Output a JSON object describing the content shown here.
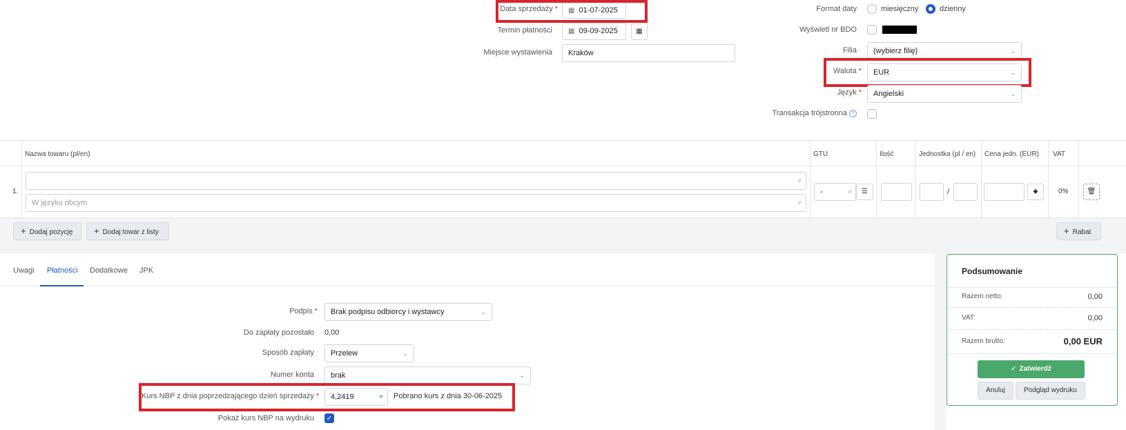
{
  "header": {
    "data_sprzedazy": {
      "label": "Data sprzedaży",
      "required": "*",
      "value": "01-07-2025"
    },
    "termin_platnosci": {
      "label": "Termin płatności",
      "value": "09-09-2025"
    },
    "miejsce_wystawienia": {
      "label": "Miejsce wystawienia",
      "value": "Kraków"
    },
    "format_daty": {
      "label": "Format daty",
      "option_monthly": "miesięczny",
      "option_daily": "dzienny",
      "selected": "dzienny"
    },
    "wyswietl_bdo": {
      "label": "Wyświetl nr BDO"
    },
    "filia": {
      "label": "Filia",
      "value": "(wybierz filię)"
    },
    "waluta": {
      "label": "Waluta",
      "required": "*",
      "value": "EUR"
    },
    "jezyk": {
      "label": "Język",
      "required": "*",
      "value": "Angielski"
    },
    "transakcja": {
      "label": "Transakcja trójstronna"
    }
  },
  "items_table": {
    "columns": {
      "name": "Nazwa towaru (pl/en)",
      "gtu": "GTU",
      "qty": "Ilość",
      "unit": "Jednostka (pl / en)",
      "price": "Cena jedn. (EUR)",
      "vat": "VAT"
    },
    "row": {
      "number": "1.",
      "name_value": "",
      "foreign_placeholder": "W języku obcym",
      "gtu_value": "-",
      "unit_sep": "/",
      "vat": "0%"
    },
    "add_position": "Dodaj pozycję",
    "add_from_list": "Dodaj towar z listy",
    "discount": "Rabat"
  },
  "tabs": [
    "Uwagi",
    "Płatności",
    "Dodatkowe",
    "JPK"
  ],
  "active_tab": "Płatności",
  "payments": {
    "podpis": {
      "label": "Podpis",
      "required": "*",
      "value": "Brak podpisu odbiorcy i wystawcy"
    },
    "do_zaplaty": {
      "label": "Do zapłaty pozostało",
      "value": "0,00"
    },
    "sposob": {
      "label": "Sposób zapłaty",
      "value": "Przelew"
    },
    "numer_konta": {
      "label": "Numer konta",
      "value": "brak"
    },
    "kurs_nbp": {
      "label": "Kurs NBP z dnia poprzedzającego dzień sprzedaży",
      "required": "*",
      "value": "4,2419",
      "info": "Pobrano kurs z dnia 30-06-2025"
    },
    "pokaz_kurs": {
      "label": "Pokaż kurs NBP na wydruku",
      "checked": true
    }
  },
  "summary": {
    "title": "Podsumowanie",
    "netto_label": "Razem netto:",
    "netto_value": "0,00",
    "vat_label": "VAT:",
    "vat_value": "0,00",
    "brutto_label": "Razem brutto:",
    "brutto_value": "0,00 EUR",
    "confirm": "Zatwierdź",
    "cancel": "Anuluj",
    "preview": "Podgląd wydruku"
  },
  "colors": {
    "highlight": "#d9232d",
    "accent": "#2457c5",
    "confirm": "#4aa86b"
  }
}
